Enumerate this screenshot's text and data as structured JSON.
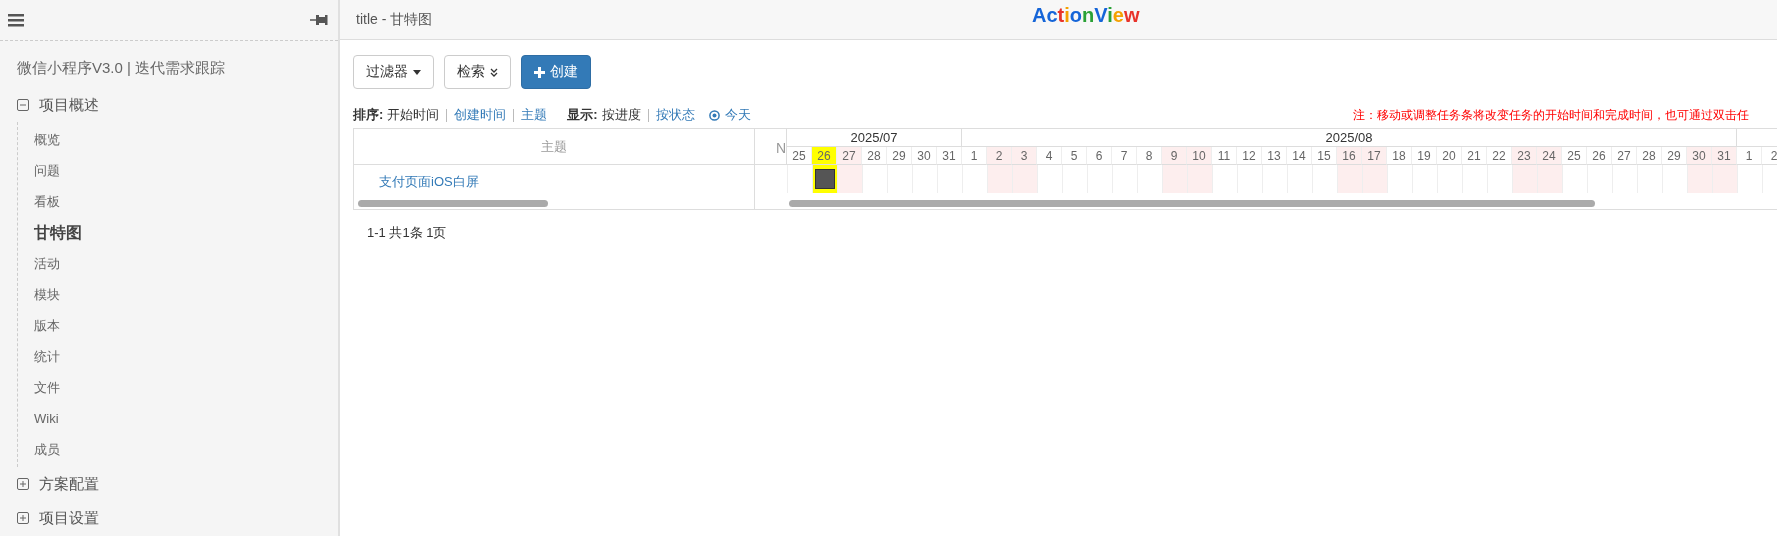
{
  "header": {
    "title": "title - 甘特图",
    "logo": [
      {
        "text": "A",
        "color": "#1565d8"
      },
      {
        "text": "c",
        "color": "#1565d8"
      },
      {
        "text": "t",
        "color": "#e8332a"
      },
      {
        "text": "i",
        "color": "#f5a000"
      },
      {
        "text": "o",
        "color": "#1565d8"
      },
      {
        "text": "n",
        "color": "#2aa136"
      },
      {
        "text": "V",
        "color": "#1565d8"
      },
      {
        "text": "i",
        "color": "#2aa136"
      },
      {
        "text": "e",
        "color": "#f5a000"
      },
      {
        "text": "w",
        "color": "#e8332a"
      }
    ]
  },
  "sidebar": {
    "project": "微信小程序V3.0 | 迭代需求跟踪",
    "groups": [
      {
        "label": "项目概述",
        "expanded": true,
        "children": [
          {
            "label": "概览",
            "selected": false
          },
          {
            "label": "问题",
            "selected": false
          },
          {
            "label": "看板",
            "selected": false
          },
          {
            "label": "甘特图",
            "selected": true
          },
          {
            "label": "活动",
            "selected": false
          },
          {
            "label": "模块",
            "selected": false
          },
          {
            "label": "版本",
            "selected": false
          },
          {
            "label": "统计",
            "selected": false
          },
          {
            "label": "文件",
            "selected": false
          },
          {
            "label": "Wiki",
            "selected": false
          },
          {
            "label": "成员",
            "selected": false
          }
        ]
      },
      {
        "label": "方案配置",
        "expanded": false
      },
      {
        "label": "项目设置",
        "expanded": false
      }
    ]
  },
  "toolbar": {
    "buttons": [
      {
        "kind": "dropdown",
        "label": "过滤器"
      },
      {
        "kind": "expand",
        "label": "检索"
      },
      {
        "kind": "primary",
        "label": "创建"
      }
    ]
  },
  "sort": {
    "label": "排序:",
    "options": [
      {
        "label": "开始时间",
        "selected": true
      },
      {
        "label": "创建时间",
        "selected": false
      },
      {
        "label": "主题",
        "selected": false
      }
    ]
  },
  "display": {
    "label": "显示:",
    "options": [
      {
        "label": "按进度",
        "selected": true
      },
      {
        "label": "按状态",
        "selected": false
      }
    ]
  },
  "today": "今天",
  "note": "注：移动或调整任务条将改变任务的开始时间和完成时间，也可通过双击任",
  "gantt": {
    "columns": [
      "主题",
      "N"
    ],
    "months": [
      {
        "label": "2025/07",
        "days": [
          {
            "label": "25",
            "weekend": false,
            "today": false
          },
          {
            "label": "26",
            "weekend": true,
            "today": true,
            "task_bar": true
          },
          {
            "label": "27",
            "weekend": true,
            "today": false
          },
          {
            "label": "28",
            "weekend": false,
            "today": false
          },
          {
            "label": "29",
            "weekend": false,
            "today": false
          },
          {
            "label": "30",
            "weekend": false,
            "today": false
          },
          {
            "label": "31",
            "weekend": false,
            "today": false
          }
        ]
      },
      {
        "label": "2025/08",
        "days": [
          {
            "label": "1",
            "weekend": false,
            "today": false
          },
          {
            "label": "2",
            "weekend": true,
            "today": false
          },
          {
            "label": "3",
            "weekend": true,
            "today": false
          },
          {
            "label": "4",
            "weekend": false,
            "today": false
          },
          {
            "label": "5",
            "weekend": false,
            "today": false
          },
          {
            "label": "6",
            "weekend": false,
            "today": false
          },
          {
            "label": "7",
            "weekend": false,
            "today": false
          },
          {
            "label": "8",
            "weekend": false,
            "today": false
          },
          {
            "label": "9",
            "weekend": true,
            "today": false
          },
          {
            "label": "10",
            "weekend": true,
            "today": false
          },
          {
            "label": "11",
            "weekend": false,
            "today": false
          },
          {
            "label": "12",
            "weekend": false,
            "today": false
          },
          {
            "label": "13",
            "weekend": false,
            "today": false
          },
          {
            "label": "14",
            "weekend": false,
            "today": false
          },
          {
            "label": "15",
            "weekend": false,
            "today": false
          },
          {
            "label": "16",
            "weekend": true,
            "today": false
          },
          {
            "label": "17",
            "weekend": true,
            "today": false
          },
          {
            "label": "18",
            "weekend": false,
            "today": false
          },
          {
            "label": "19",
            "weekend": false,
            "today": false
          },
          {
            "label": "20",
            "weekend": false,
            "today": false
          },
          {
            "label": "21",
            "weekend": false,
            "today": false
          },
          {
            "label": "22",
            "weekend": false,
            "today": false
          },
          {
            "label": "23",
            "weekend": true,
            "today": false
          },
          {
            "label": "24",
            "weekend": true,
            "today": false
          },
          {
            "label": "25",
            "weekend": false,
            "today": false
          },
          {
            "label": "26",
            "weekend": false,
            "today": false
          },
          {
            "label": "27",
            "weekend": false,
            "today": false
          },
          {
            "label": "28",
            "weekend": false,
            "today": false
          },
          {
            "label": "29",
            "weekend": false,
            "today": false
          },
          {
            "label": "30",
            "weekend": true,
            "today": false
          },
          {
            "label": "31",
            "weekend": true,
            "today": false
          }
        ]
      },
      {
        "days": [
          {
            "label": "1",
            "weekend": false,
            "today": false
          },
          {
            "label": "2",
            "weekend": false,
            "today": false
          }
        ]
      }
    ],
    "rows": [
      {
        "title": "支付页面iOS白屏"
      }
    ]
  },
  "pagination": "1-1 共1条 1页"
}
